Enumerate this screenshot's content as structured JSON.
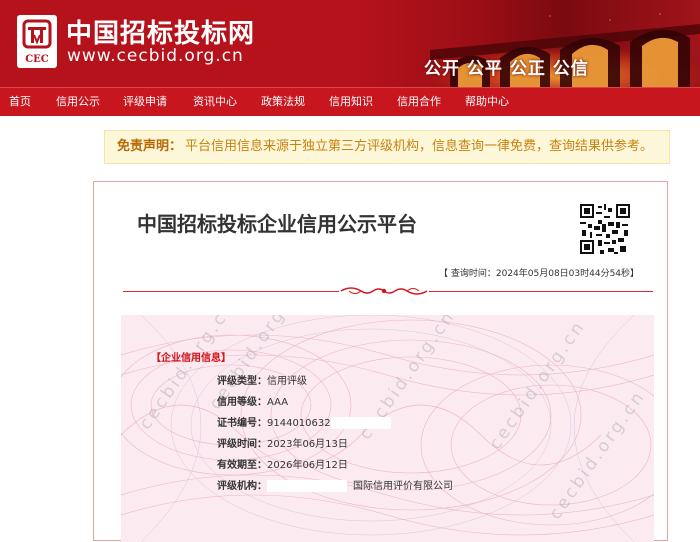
{
  "header": {
    "site_title": "中国招标投标网",
    "site_url": "www.cecbid.org.cn",
    "logo_text": "CEC",
    "slogan": "公开 公平 公正 公信"
  },
  "nav": {
    "items": [
      "首页",
      "信用公示",
      "评级申请",
      "资讯中心",
      "政策法规",
      "信用知识",
      "信用合作",
      "帮助中心"
    ]
  },
  "disclaimer": {
    "label": "免责声明：",
    "text": "平台信用信息来源于独立第三方评级机构，信息查询一律免费，查询结果供参考。"
  },
  "card": {
    "title": "中国招标投标企业信用公示平台",
    "query_time": "【 查询时间：2024年05月08日03时44分54秒】",
    "section_label": "【企业信用信息】",
    "watermark": "cecbid.org.cn",
    "fields": [
      {
        "key": "评级类型：",
        "value": "信用评级"
      },
      {
        "key": "信用等级：",
        "value": "AAA"
      },
      {
        "key": "证书编号：",
        "value": "9144010632"
      },
      {
        "key": "评级时间：",
        "value": "2023年06月13日"
      },
      {
        "key": "有效期至：",
        "value": "2026年06月12日"
      },
      {
        "key": "评级机构：",
        "value": "国际信用评价有限公司"
      }
    ]
  },
  "colors": {
    "brand_red": "#b5121b",
    "nav_red": "#c8161f",
    "disclaimer_bg": "#fdf7da",
    "disclaimer_text": "#c9820e"
  }
}
